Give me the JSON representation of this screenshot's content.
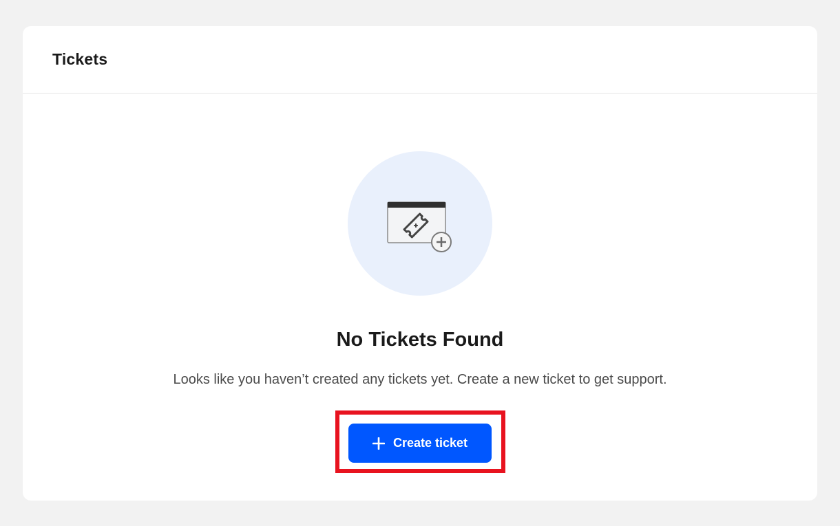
{
  "card": {
    "title": "Tickets"
  },
  "empty_state": {
    "icon": "ticket-add-icon",
    "title": "No Tickets Found",
    "description": "Looks like you haven’t created any tickets yet. Create a new ticket to get support."
  },
  "actions": {
    "create_label": "Create ticket",
    "create_icon": "plus-icon"
  },
  "colors": {
    "accent": "#0057ff",
    "highlight": "#e8131f",
    "illustration_bg": "#e9f0fc"
  }
}
